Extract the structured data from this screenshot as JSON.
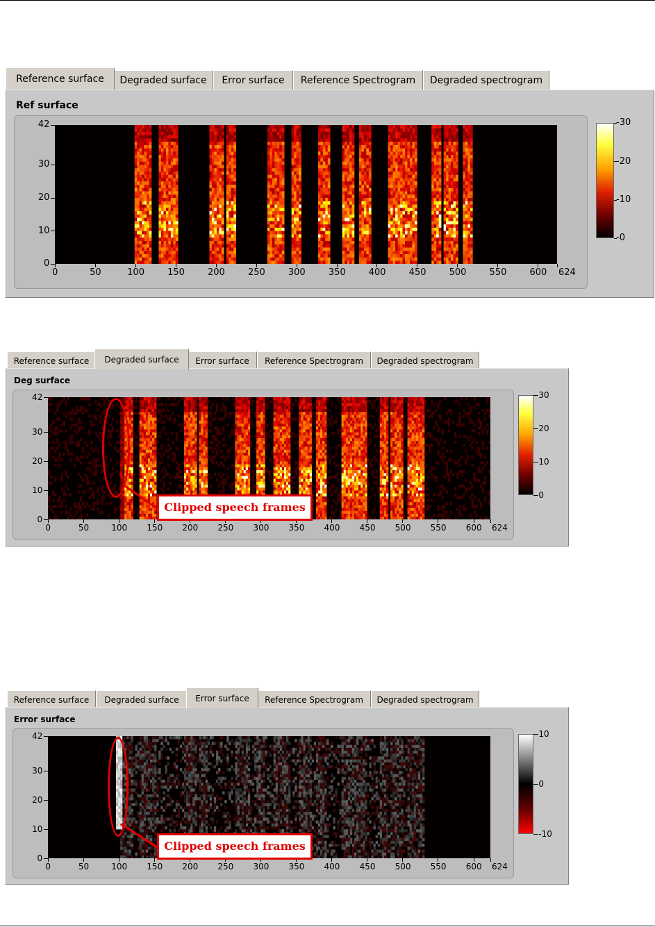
{
  "panels": [
    {
      "id": "ref",
      "tabs": [
        "Reference surface",
        "Degraded surface",
        "Error surface",
        "Reference Spectrogram",
        "Degraded spectrogram"
      ],
      "active_tab": 0,
      "title": "Ref surface",
      "colormap": "heat",
      "x_ticks": [
        "0",
        "50",
        "100",
        "150",
        "200",
        "250",
        "300",
        "350",
        "400",
        "450",
        "500",
        "550",
        "600",
        "624"
      ],
      "y_ticks": [
        "0",
        "10",
        "20",
        "30",
        "42"
      ],
      "colorbar_ticks": [
        "-30",
        "-20",
        "-10",
        "-0"
      ],
      "annotation": null
    },
    {
      "id": "deg",
      "tabs": [
        "Reference surface",
        "Degraded surface",
        "Error surface",
        "Reference Spectrogram",
        "Degraded spectrogram"
      ],
      "active_tab": 1,
      "title": "Deg surface",
      "colormap": "heat",
      "x_ticks": [
        "0",
        "50",
        "100",
        "150",
        "200",
        "250",
        "300",
        "350",
        "400",
        "450",
        "500",
        "550",
        "600",
        "624"
      ],
      "y_ticks": [
        "0",
        "10",
        "20",
        "30",
        "42"
      ],
      "colorbar_ticks": [
        "-30",
        "-20",
        "-10",
        "-0"
      ],
      "annotation": "Clipped speech frames"
    },
    {
      "id": "err",
      "tabs": [
        "Reference surface",
        "Degraded surface",
        "Error surface",
        "Reference Spectrogram",
        "Degraded spectrogram"
      ],
      "active_tab": 2,
      "title": "Error surface",
      "colormap": "error",
      "x_ticks": [
        "0",
        "50",
        "100",
        "150",
        "200",
        "250",
        "300",
        "350",
        "400",
        "450",
        "500",
        "550",
        "600",
        "624"
      ],
      "y_ticks": [
        "0",
        "10",
        "20",
        "30",
        "42"
      ],
      "colorbar_ticks": [
        "-10",
        "-0",
        "--10"
      ],
      "annotation": "Clipped speech frames"
    }
  ],
  "colors": {
    "annotation": "#e00000",
    "panel_bg": "#c8c8c8",
    "plot_bg": "#050000"
  }
}
